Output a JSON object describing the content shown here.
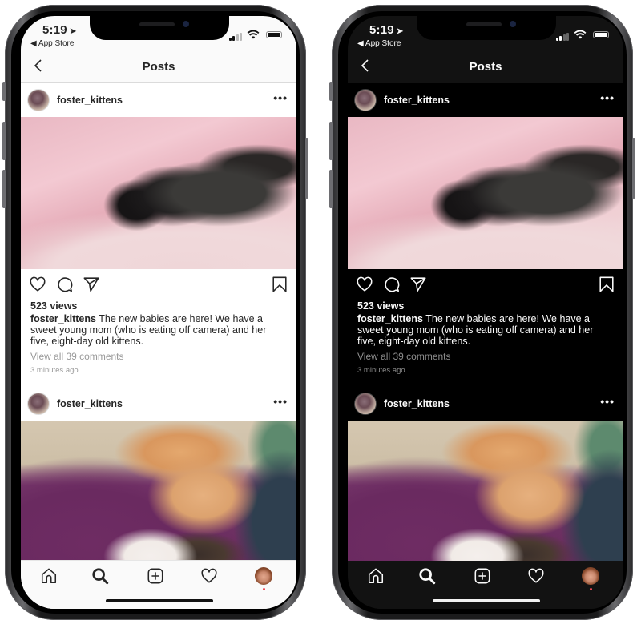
{
  "phones": {
    "light": {
      "theme": "light",
      "status": {
        "time": "5:19",
        "back_app": "App Store"
      },
      "navbar": {
        "title": "Posts"
      },
      "post1": {
        "username": "foster_kittens",
        "views": "523 views",
        "caption_user": "foster_kittens",
        "caption_text": " The new babies are here! We have a sweet young mom (who is eating off camera) and her five, eight-day old kittens.",
        "comments_link": "View all 39 comments",
        "timestamp": "3 minutes ago"
      },
      "post2": {
        "username": "foster_kittens"
      }
    },
    "dark": {
      "theme": "dark",
      "status": {
        "time": "5:19",
        "back_app": "App Store"
      },
      "navbar": {
        "title": "Posts"
      },
      "post1": {
        "username": "foster_kittens",
        "views": "523 views",
        "caption_user": "foster_kittens",
        "caption_text": " The new babies are here! We have a sweet young mom (who is eating off camera) and her five, eight-day old kittens.",
        "comments_link": "View all 39 comments",
        "timestamp": "3 minutes ago"
      },
      "post2": {
        "username": "foster_kittens"
      }
    }
  },
  "icons": {
    "status": [
      "location-arrow-icon",
      "cellular-signal-icon",
      "wifi-icon",
      "battery-icon"
    ],
    "post_actions": [
      "heart-icon",
      "comment-icon",
      "share-icon",
      "bookmark-icon"
    ],
    "tabbar": [
      "home-icon",
      "search-icon",
      "new-post-icon",
      "activity-heart-icon",
      "profile-avatar"
    ]
  },
  "colors": {
    "light_bg": "#ffffff",
    "dark_bg": "#000000",
    "notification_dot": "#ed4956",
    "secondary_text": "#999999"
  }
}
